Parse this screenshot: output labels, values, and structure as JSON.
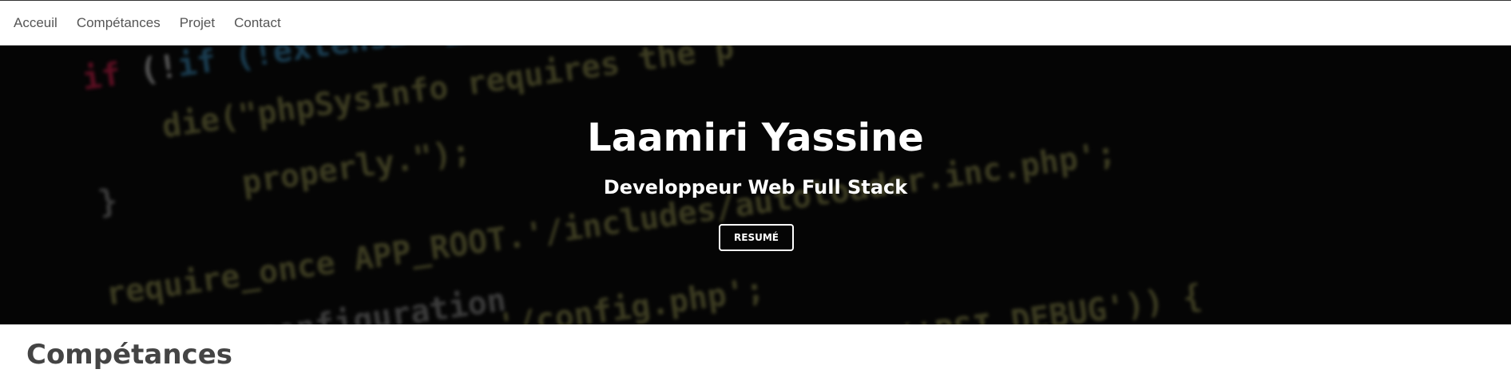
{
  "nav": {
    "items": [
      {
        "label": "Acceuil"
      },
      {
        "label": "Compétances"
      },
      {
        "label": "Projet"
      },
      {
        "label": "Contact"
      }
    ]
  },
  "hero": {
    "title": "Laamiri Yassine",
    "subtitle": "Developpeur Web Full Stack",
    "button_label": "RESUMÉ",
    "background_code": [
      "if (!extension_loaded(",
      "die(\"phpSysInfo requires the p",
      "properly.\");",
      "}",
      "require_once APP_ROOT.'/includes/autoloader.inc.php';",
      "configuration",
      "'/config.php';",
      "('PSI_DEBUG')) {"
    ]
  },
  "sections": {
    "skills_title": "Compétances"
  }
}
